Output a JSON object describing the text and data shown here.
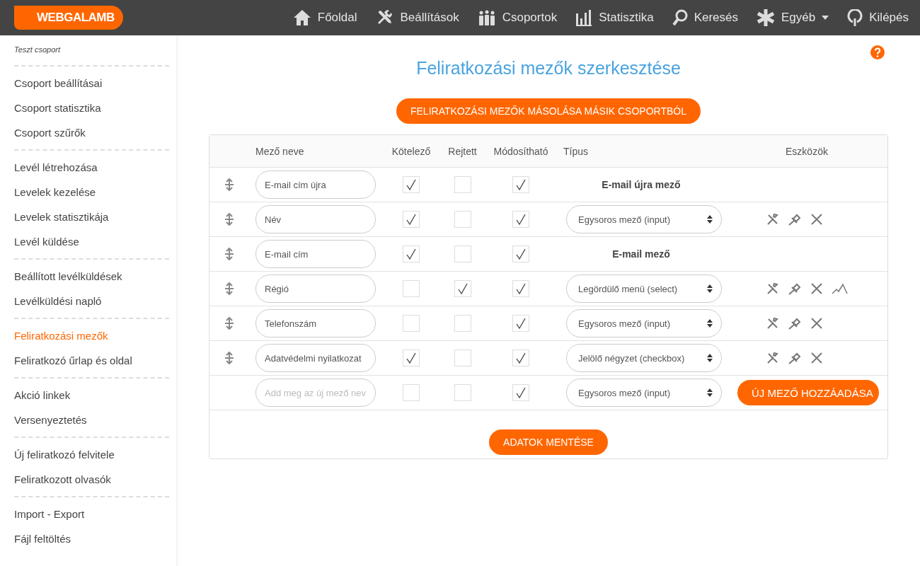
{
  "header": {
    "logo": "WEBGALAMB",
    "nav": [
      {
        "label": "Főoldal",
        "dropdown": false
      },
      {
        "label": "Beállítások",
        "dropdown": false
      },
      {
        "label": "Csoportok",
        "dropdown": false
      },
      {
        "label": "Statisztika",
        "dropdown": false
      },
      {
        "label": "Keresés",
        "dropdown": false
      },
      {
        "label": "Egyéb",
        "dropdown": true
      },
      {
        "label": "Kilépés",
        "dropdown": false
      }
    ]
  },
  "sidebar": {
    "group_title": "Teszt csoport",
    "sections": [
      {
        "items": [
          {
            "label": "Csoport beállításai",
            "selected": false
          },
          {
            "label": "Csoport statisztika",
            "selected": false
          },
          {
            "label": "Csoport szűrők",
            "selected": false
          }
        ]
      },
      {
        "items": [
          {
            "label": "Levél létrehozása",
            "selected": false
          },
          {
            "label": "Levelek kezelése",
            "selected": false
          },
          {
            "label": "Levelek statisztikája",
            "selected": false
          },
          {
            "label": "Levél küldése",
            "selected": false
          }
        ]
      },
      {
        "items": [
          {
            "label": "Beállított levélküldések",
            "selected": false
          },
          {
            "label": "Levélküldési napló",
            "selected": false
          }
        ]
      },
      {
        "items": [
          {
            "label": "Feliratkozási mezők",
            "selected": true
          },
          {
            "label": "Feliratkozó űrlap és oldal",
            "selected": false
          }
        ]
      },
      {
        "items": [
          {
            "label": "Akció linkek",
            "selected": false
          },
          {
            "label": "Versenyeztetés",
            "selected": false
          }
        ]
      },
      {
        "items": [
          {
            "label": "Új feliratkozó felvitele",
            "selected": false
          },
          {
            "label": "Feliratkozott olvasók",
            "selected": false
          }
        ]
      },
      {
        "items": [
          {
            "label": "Import - Export",
            "selected": false
          },
          {
            "label": "Fájl feltöltés",
            "selected": false
          }
        ]
      }
    ]
  },
  "page": {
    "title": "Feliratkozási mezők szerkesztése",
    "copy_button": "FELIRATKOZÁSI MEZŐK MÁSOLÁSA MÁSIK CSOPORTBÓL",
    "table": {
      "columns": [
        "Mező neve",
        "Kötelező",
        "Rejtett",
        "Módosítható",
        "Típus",
        "Eszközök"
      ],
      "rows": [
        {
          "kind": "fixed",
          "name": "E-mail cím újra",
          "required": true,
          "hidden": false,
          "editable": true,
          "type": "E-mail újra mező"
        },
        {
          "kind": "select",
          "name": "Név",
          "required": true,
          "hidden": false,
          "editable": true,
          "type": "Egysoros mező (input)",
          "chart_tool": false
        },
        {
          "kind": "fixed",
          "name": "E-mail cím",
          "required": true,
          "hidden": false,
          "editable": true,
          "type": "E-mail mező"
        },
        {
          "kind": "select",
          "name": "Régió",
          "required": false,
          "hidden": true,
          "editable": true,
          "type": "Legördülő menü (select)",
          "chart_tool": true
        },
        {
          "kind": "select",
          "name": "Telefonszám",
          "required": false,
          "hidden": false,
          "editable": true,
          "type": "Egysoros mező (input)",
          "chart_tool": false
        },
        {
          "kind": "select",
          "name": "Adatvédelmi nyilatkozat",
          "required": true,
          "hidden": false,
          "editable": true,
          "type": "Jelölő négyzet (checkbox)",
          "chart_tool": false
        }
      ],
      "new_row": {
        "placeholder": "Add meg az új mező nev",
        "required": false,
        "hidden": false,
        "editable": true,
        "type": "Egysoros mező (input)",
        "add_button": "ÚJ MEZŐ HOZZÁADÁSA"
      },
      "save_button": "ADATOK MENTÉSE"
    }
  }
}
